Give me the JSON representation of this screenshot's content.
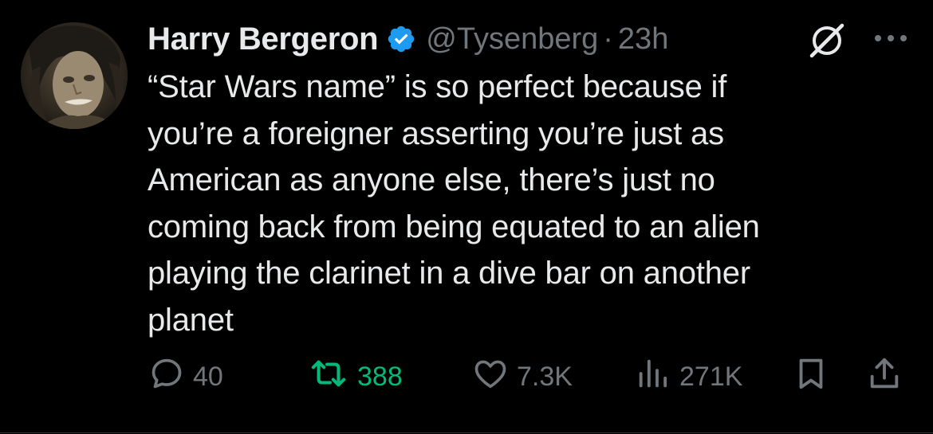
{
  "tweet": {
    "author": {
      "display_name": "Harry Bergeron",
      "handle": "@Tysenberg",
      "verified": true
    },
    "separator": "·",
    "time": "23h",
    "text_lines": [
      "“Star Wars name” is so perfect because if",
      "you’re a foreigner asserting you’re just as",
      "American as anyone else, there’s just no",
      "coming back from being equated to an alien",
      "playing the clarinet in a dive bar on another",
      "planet"
    ],
    "stats": {
      "replies": "40",
      "retweets": "388",
      "likes": "7.3K",
      "views": "271K"
    }
  },
  "colors": {
    "background": "#000000",
    "text": "#e7e9ea",
    "secondary": "#71767b",
    "verified": "#1d9bf0",
    "retweeted": "#00ba7c"
  },
  "icons": [
    "verified-badge-icon",
    "grok-icon",
    "more-icon",
    "reply-icon",
    "retweet-icon",
    "like-icon",
    "views-icon",
    "bookmark-icon",
    "share-icon"
  ]
}
